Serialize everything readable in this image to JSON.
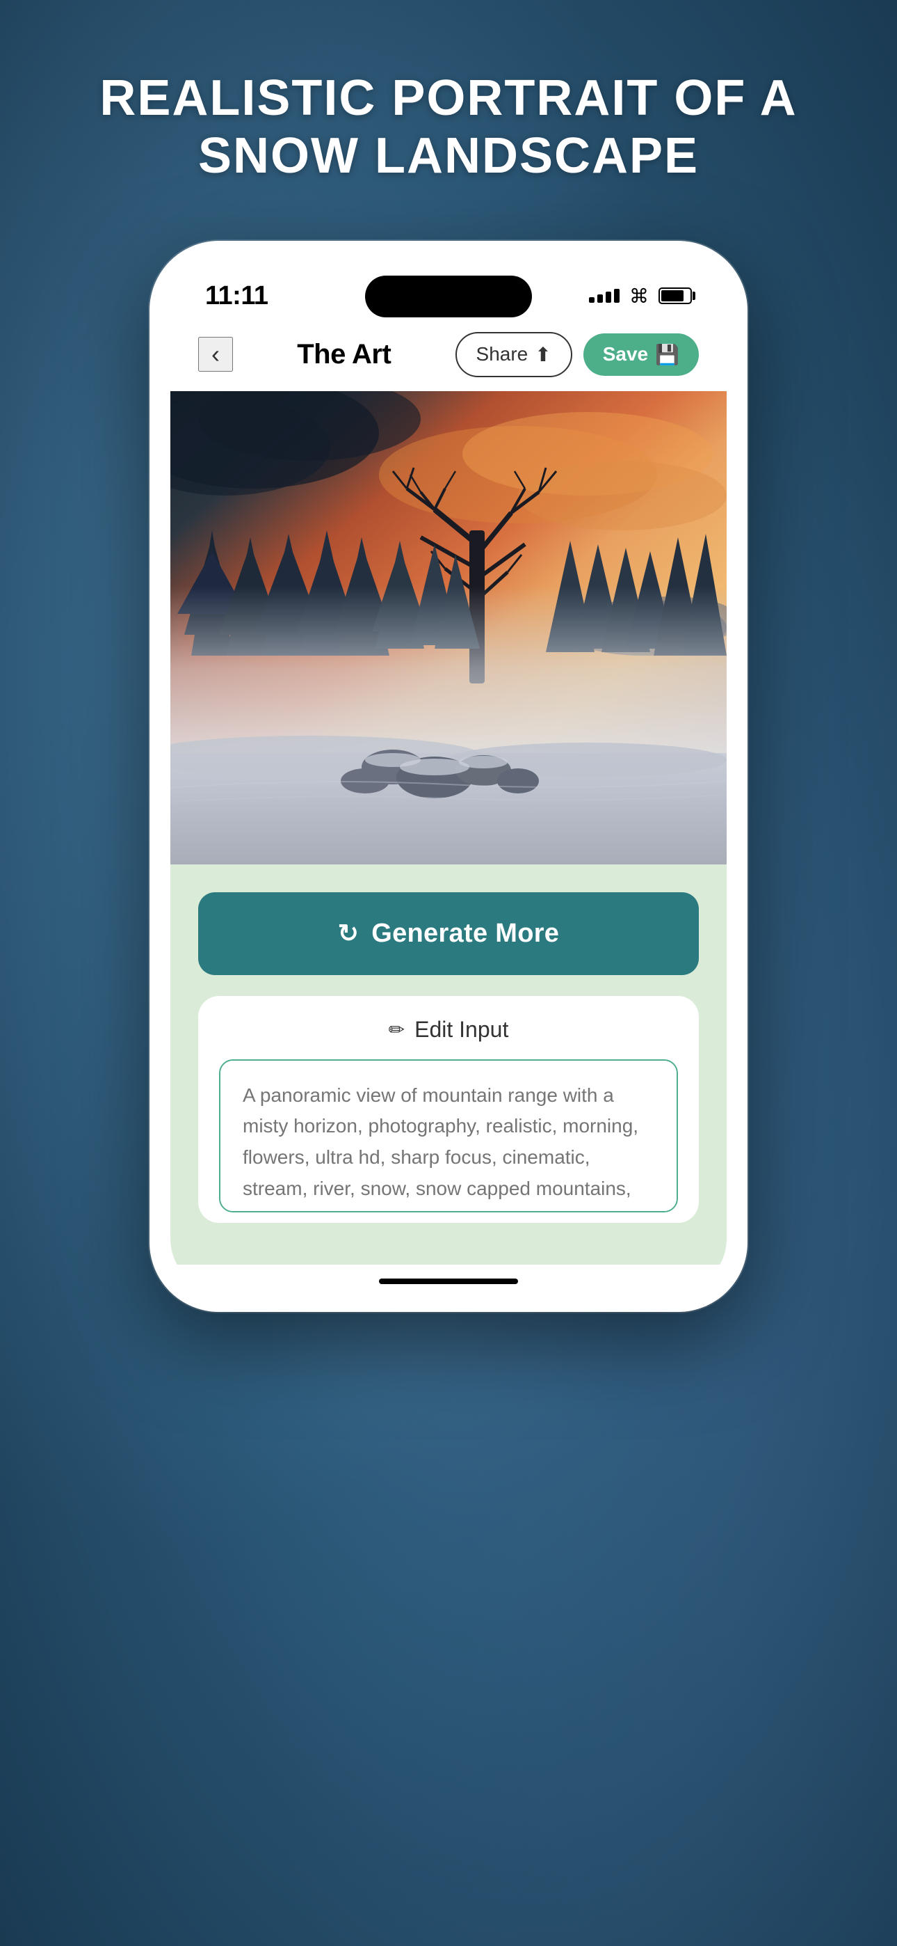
{
  "page": {
    "title": "REALISTIC PORTRAIT OF A\nSNOW LANDSCAPE"
  },
  "status_bar": {
    "time": "11:11",
    "wifi": "wifi",
    "battery": "battery"
  },
  "nav": {
    "back_label": "‹",
    "title": "The Art",
    "share_label": "Share",
    "save_label": "Save"
  },
  "generate_button": {
    "label": "Generate More",
    "icon": "↻"
  },
  "edit_input": {
    "label": "Edit Input",
    "pencil": "✏",
    "placeholder": "A panoramic view of mountain range with a misty horizon, photography, realistic, morning, flowers, ultra hd, sharp focus, cinematic, stream, river, snow, snow capped mountains, dawn, dark colors, dramatic light"
  },
  "colors": {
    "background": "#4a7a9b",
    "generate_btn": "#2a7a80",
    "save_btn": "#4caf8a",
    "content_bg": "#daecd8"
  }
}
